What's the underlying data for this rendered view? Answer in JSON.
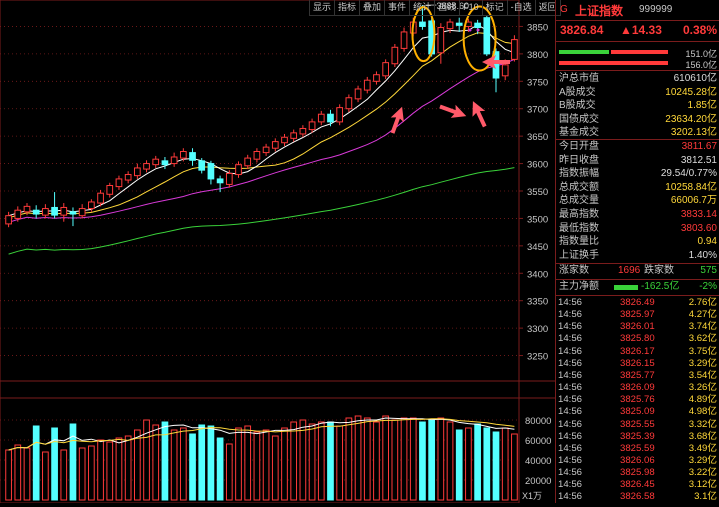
{
  "toolbar": [
    "显示",
    "指标",
    "叠加",
    "事件",
    "统计",
    "画线",
    "F10",
    "标记",
    "-自选",
    "返回"
  ],
  "colors": {
    "up": "#ff3a3a",
    "down": "#54ffff",
    "ma5": "#ffffff",
    "ma10": "#ffd83a",
    "ma20": "#d83ad8",
    "ma60": "#3ad23a",
    "grid": "#7a1c1c"
  },
  "chart_data": {
    "type": "candlestick",
    "price_axis": {
      "min": 3250,
      "max": 3850,
      "ticks": [
        3850,
        3800,
        3750,
        3700,
        3650,
        3600,
        3550,
        3500,
        3450,
        3400,
        3350,
        3300,
        3250
      ]
    },
    "high_annotation": "3888.60",
    "volume_axis": {
      "min": 0,
      "max": 90000,
      "ticks": [
        80000,
        60000,
        40000,
        20000
      ],
      "unit_label": "X1万"
    },
    "candles": [
      {
        "o": 3490,
        "c": 3505,
        "h": 3512,
        "l": 3484
      },
      {
        "o": 3500,
        "c": 3515,
        "h": 3522,
        "l": 3494
      },
      {
        "o": 3512,
        "c": 3522,
        "h": 3528,
        "l": 3506
      },
      {
        "o": 3515,
        "c": 3508,
        "h": 3524,
        "l": 3500
      },
      {
        "o": 3506,
        "c": 3518,
        "h": 3526,
        "l": 3500
      },
      {
        "o": 3520,
        "c": 3506,
        "h": 3548,
        "l": 3500
      },
      {
        "o": 3506,
        "c": 3520,
        "h": 3528,
        "l": 3494
      },
      {
        "o": 3512,
        "c": 3508,
        "h": 3520,
        "l": 3486
      },
      {
        "o": 3505,
        "c": 3518,
        "h": 3526,
        "l": 3500
      },
      {
        "o": 3518,
        "c": 3530,
        "h": 3535,
        "l": 3512
      },
      {
        "o": 3528,
        "c": 3546,
        "h": 3552,
        "l": 3522
      },
      {
        "o": 3544,
        "c": 3560,
        "h": 3565,
        "l": 3538
      },
      {
        "o": 3558,
        "c": 3572,
        "h": 3578,
        "l": 3552
      },
      {
        "o": 3570,
        "c": 3580,
        "h": 3586,
        "l": 3564
      },
      {
        "o": 3578,
        "c": 3592,
        "h": 3600,
        "l": 3572
      },
      {
        "o": 3590,
        "c": 3600,
        "h": 3606,
        "l": 3584
      },
      {
        "o": 3598,
        "c": 3608,
        "h": 3614,
        "l": 3592
      },
      {
        "o": 3605,
        "c": 3598,
        "h": 3612,
        "l": 3590
      },
      {
        "o": 3600,
        "c": 3612,
        "h": 3620,
        "l": 3594
      },
      {
        "o": 3610,
        "c": 3622,
        "h": 3628,
        "l": 3604
      },
      {
        "o": 3620,
        "c": 3606,
        "h": 3628,
        "l": 3596
      },
      {
        "o": 3605,
        "c": 3588,
        "h": 3610,
        "l": 3582
      },
      {
        "o": 3600,
        "c": 3572,
        "h": 3605,
        "l": 3562
      },
      {
        "o": 3572,
        "c": 3565,
        "h": 3578,
        "l": 3548
      },
      {
        "o": 3562,
        "c": 3582,
        "h": 3588,
        "l": 3556
      },
      {
        "o": 3580,
        "c": 3598,
        "h": 3604,
        "l": 3574
      },
      {
        "o": 3596,
        "c": 3610,
        "h": 3616,
        "l": 3590
      },
      {
        "o": 3608,
        "c": 3622,
        "h": 3628,
        "l": 3602
      },
      {
        "o": 3620,
        "c": 3630,
        "h": 3636,
        "l": 3614
      },
      {
        "o": 3628,
        "c": 3640,
        "h": 3646,
        "l": 3622
      },
      {
        "o": 3638,
        "c": 3648,
        "h": 3654,
        "l": 3632
      },
      {
        "o": 3646,
        "c": 3656,
        "h": 3662,
        "l": 3640
      },
      {
        "o": 3654,
        "c": 3664,
        "h": 3670,
        "l": 3648
      },
      {
        "o": 3662,
        "c": 3676,
        "h": 3682,
        "l": 3656
      },
      {
        "o": 3676,
        "c": 3690,
        "h": 3696,
        "l": 3670
      },
      {
        "o": 3690,
        "c": 3676,
        "h": 3698,
        "l": 3668
      },
      {
        "o": 3676,
        "c": 3702,
        "h": 3708,
        "l": 3670
      },
      {
        "o": 3700,
        "c": 3720,
        "h": 3726,
        "l": 3694
      },
      {
        "o": 3718,
        "c": 3736,
        "h": 3742,
        "l": 3712
      },
      {
        "o": 3734,
        "c": 3752,
        "h": 3758,
        "l": 3728
      },
      {
        "o": 3750,
        "c": 3762,
        "h": 3768,
        "l": 3744
      },
      {
        "o": 3760,
        "c": 3784,
        "h": 3790,
        "l": 3754
      },
      {
        "o": 3782,
        "c": 3812,
        "h": 3818,
        "l": 3776
      },
      {
        "o": 3810,
        "c": 3840,
        "h": 3848,
        "l": 3804
      },
      {
        "o": 3838,
        "c": 3858,
        "h": 3866,
        "l": 3832
      },
      {
        "o": 3858,
        "c": 3850,
        "h": 3889,
        "l": 3844
      },
      {
        "o": 3860,
        "c": 3800,
        "h": 3866,
        "l": 3795
      },
      {
        "o": 3802,
        "c": 3848,
        "h": 3856,
        "l": 3782
      },
      {
        "o": 3846,
        "c": 3858,
        "h": 3864,
        "l": 3838
      },
      {
        "o": 3856,
        "c": 3852,
        "h": 3866,
        "l": 3840
      },
      {
        "o": 3850,
        "c": 3858,
        "h": 3864,
        "l": 3840
      },
      {
        "o": 3856,
        "c": 3848,
        "h": 3862,
        "l": 3836
      },
      {
        "o": 3866,
        "c": 3800,
        "h": 3870,
        "l": 3796
      },
      {
        "o": 3804,
        "c": 3756,
        "h": 3810,
        "l": 3730
      },
      {
        "o": 3760,
        "c": 3780,
        "h": 3790,
        "l": 3752
      },
      {
        "o": 3790,
        "c": 3826,
        "h": 3834,
        "l": 3786
      }
    ],
    "volumes": [
      50000,
      55000,
      52000,
      74000,
      48000,
      72000,
      50000,
      76000,
      52000,
      54000,
      60000,
      58000,
      62000,
      64000,
      70000,
      80000,
      75000,
      78000,
      70000,
      72000,
      66000,
      75000,
      74000,
      62000,
      56000,
      72000,
      74000,
      68000,
      70000,
      64000,
      72000,
      78000,
      80000,
      76000,
      78000,
      78000,
      74000,
      82000,
      84000,
      82000,
      78000,
      84000,
      80000,
      82000,
      82000,
      78000,
      80000,
      82000,
      78000,
      70000,
      72000,
      76000,
      72000,
      68000,
      72000,
      66000
    ],
    "ma_labels": [
      "",
      "",
      "",
      ""
    ]
  },
  "panel": {
    "index_code_prefix": "G",
    "index_name": "上证指数",
    "index_code": "999999",
    "price": "3826.84",
    "change": "▲14.33",
    "change_pct": "0.38%",
    "bar1_val": "151.0亿",
    "bar2_val": "156.0亿",
    "stats": [
      {
        "label": "沪总市值",
        "value": "610610亿",
        "color": "white"
      },
      {
        "label": "A股成交",
        "value": "10245.28亿",
        "color": "yellow"
      },
      {
        "label": "B股成交",
        "value": "1.85亿",
        "color": "yellow"
      },
      {
        "label": "国债成交",
        "value": "23634.20亿",
        "color": "yellow"
      },
      {
        "label": "基金成交",
        "value": "3202.13亿",
        "color": "yellow"
      },
      {
        "label": "今日开盘",
        "value": "3811.67",
        "color": "red"
      },
      {
        "label": "昨日收盘",
        "value": "3812.51",
        "color": "white"
      },
      {
        "label": "指数振幅",
        "value": "29.54/0.77%",
        "color": "white"
      },
      {
        "label": "总成交额",
        "value": "10258.84亿",
        "color": "yellow"
      },
      {
        "label": "总成交量",
        "value": "66006.7万",
        "color": "yellow"
      },
      {
        "label": "最高指数",
        "value": "3833.14",
        "color": "red"
      },
      {
        "label": "最低指数",
        "value": "3803.60",
        "color": "red"
      },
      {
        "label": "指数量比",
        "value": "0.94",
        "color": "yellow"
      },
      {
        "label": "上证换手",
        "value": "1.40%",
        "color": "white"
      }
    ],
    "rise_label": "涨家数",
    "rise_count": "1696",
    "fall_label": "跌家数",
    "fall_count": "575",
    "flow_label": "主力净额",
    "flow_value": "-162.5亿",
    "flow_pct": "-2%",
    "ticks": [
      {
        "time": "14:56",
        "price": "3826.49",
        "vol": "2.76亿"
      },
      {
        "time": "14:56",
        "price": "3825.97",
        "vol": "4.27亿"
      },
      {
        "time": "14:56",
        "price": "3826.01",
        "vol": "3.74亿"
      },
      {
        "time": "14:56",
        "price": "3825.80",
        "vol": "3.62亿"
      },
      {
        "time": "14:56",
        "price": "3826.17",
        "vol": "3.75亿"
      },
      {
        "time": "14:56",
        "price": "3826.15",
        "vol": "3.29亿"
      },
      {
        "time": "14:56",
        "price": "3825.77",
        "vol": "3.54亿"
      },
      {
        "time": "14:56",
        "price": "3826.09",
        "vol": "3.26亿"
      },
      {
        "time": "14:56",
        "price": "3825.76",
        "vol": "4.89亿"
      },
      {
        "time": "14:56",
        "price": "3825.09",
        "vol": "4.98亿"
      },
      {
        "time": "14:56",
        "price": "3825.55",
        "vol": "3.32亿"
      },
      {
        "time": "14:56",
        "price": "3825.39",
        "vol": "3.68亿"
      },
      {
        "time": "14:56",
        "price": "3825.59",
        "vol": "3.49亿"
      },
      {
        "time": "14:56",
        "price": "3826.06",
        "vol": "3.29亿"
      },
      {
        "time": "14:56",
        "price": "3825.98",
        "vol": "3.22亿"
      },
      {
        "time": "14:56",
        "price": "3826.45",
        "vol": "3.12亿"
      },
      {
        "time": "14:56",
        "price": "3826.58",
        "vol": "3.1亿"
      }
    ]
  }
}
